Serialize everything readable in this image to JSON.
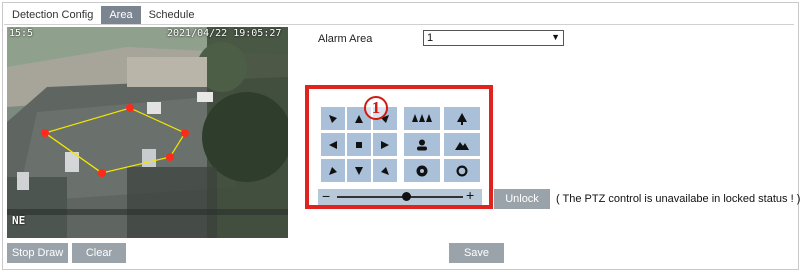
{
  "tabs": [
    {
      "label": "Detection Config",
      "active": false
    },
    {
      "label": "Area",
      "active": true
    },
    {
      "label": "Schedule",
      "active": false
    }
  ],
  "video": {
    "osd_timestamp": "2021/04/22 19:05:27",
    "osd_channel": "15:5",
    "osd_bottom": "NE"
  },
  "alarm_area": {
    "label": "Alarm Area",
    "value": "1"
  },
  "ptz": {
    "direction_icons": [
      "up-left-arrow-icon",
      "up-arrow-icon",
      "up-right-arrow-icon",
      "left-arrow-icon",
      "stop-square-icon",
      "right-arrow-icon",
      "down-left-arrow-icon",
      "down-arrow-icon",
      "down-right-arrow-icon"
    ],
    "function_icons": [
      "zoom-out-trees-icon",
      "zoom-in-tree-icon",
      "focus-near-person-icon",
      "focus-far-mountain-icon",
      "iris-close-icon",
      "iris-open-icon"
    ],
    "slider_minus": "−",
    "slider_plus": "+",
    "speed_level": 0.55,
    "callout_number": "1"
  },
  "buttons": {
    "stop_draw": "Stop Draw",
    "clear": "Clear",
    "save": "Save",
    "unlock": "Unlock"
  },
  "unlock_note": "( The PTZ control is unavailabe in locked status ! )",
  "colors": {
    "tab_active": "#7b8590",
    "ptz_button": "#a9c0d8",
    "callout_red": "#e0231e",
    "polygon_line": "#f2e600",
    "polygon_vertex": "#ff2a1a"
  }
}
